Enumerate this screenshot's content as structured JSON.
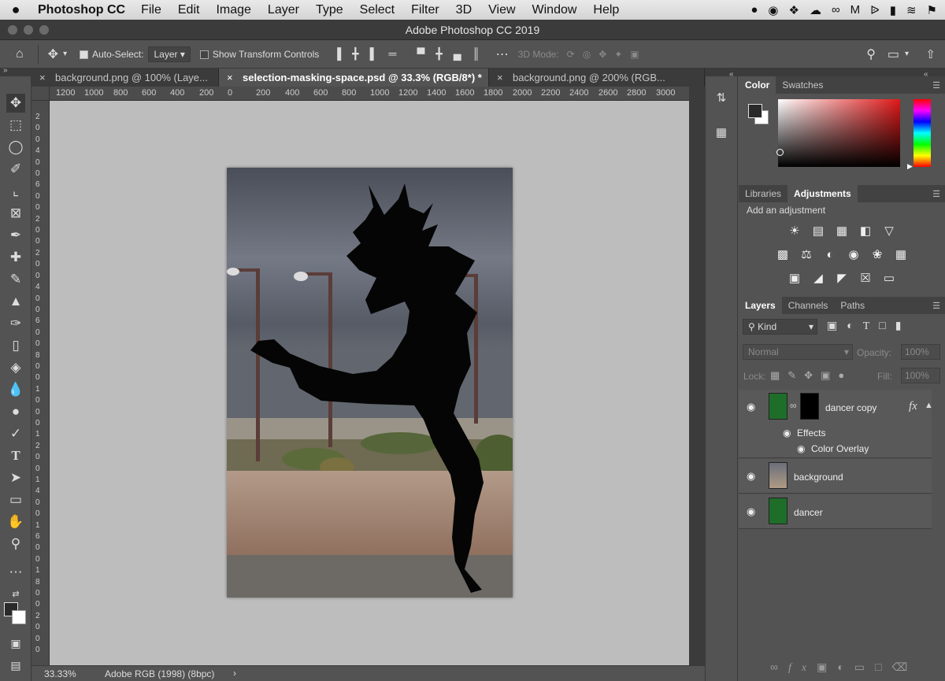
{
  "mac_menu": {
    "apple": "",
    "app_name": "Photoshop CC",
    "items": [
      "File",
      "Edit",
      "Image",
      "Layer",
      "Type",
      "Select",
      "Filter",
      "3D",
      "View",
      "Window",
      "Help"
    ]
  },
  "window_title": "Adobe Photoshop CC 2019",
  "options_bar": {
    "auto_select_label": "Auto-Select:",
    "auto_select_value": "Layer",
    "show_transform_label": "Show Transform Controls",
    "mode_3d_label": "3D Mode:"
  },
  "tabs": [
    {
      "label": "background.png @ 100% (Laye...",
      "active": false
    },
    {
      "label": "selection-masking-space.psd @ 33.3% (RGB/8*) *",
      "active": true
    },
    {
      "label": "background.png @ 200% (RGB...",
      "active": false
    }
  ],
  "ruler_h": [
    "1200",
    "1000",
    "800",
    "600",
    "400",
    "200",
    "0",
    "200",
    "400",
    "600",
    "800",
    "1000",
    "1200",
    "1400",
    "1600",
    "1800",
    "2000",
    "2200",
    "2400",
    "2600",
    "2800",
    "3000"
  ],
  "ruler_v": [
    "2",
    "0",
    "0",
    "4",
    "0",
    "0",
    "6",
    "0",
    "0",
    "2",
    "0",
    "0",
    "2",
    "0",
    "0",
    "4",
    "0",
    "0",
    "6",
    "0",
    "0",
    "8",
    "0",
    "0",
    "1",
    "0",
    "0",
    "0",
    "1",
    "2",
    "0",
    "0",
    "1",
    "4",
    "0",
    "0",
    "1",
    "6",
    "0",
    "0",
    "1",
    "8",
    "0",
    "0",
    "2",
    "0",
    "0",
    "0"
  ],
  "status": {
    "zoom": "33.33%",
    "profile": "Adobe RGB (1998) (8bpc)"
  },
  "color_panel": {
    "tabs": [
      "Color",
      "Swatches"
    ],
    "active": "Color"
  },
  "adjust_panel": {
    "tabs": [
      "Libraries",
      "Adjustments"
    ],
    "active": "Adjustments",
    "hint": "Add an adjustment"
  },
  "layers_panel": {
    "tabs": [
      "Layers",
      "Channels",
      "Paths"
    ],
    "active": "Layers",
    "kind_label": "Kind",
    "blend_mode": "Normal",
    "opacity_label": "Opacity:",
    "opacity_value": "100%",
    "lock_label": "Lock:",
    "fill_label": "Fill:",
    "fill_value": "100%",
    "layers": [
      {
        "name": "dancer copy",
        "effects_label": "Effects",
        "effect": "Color Overlay"
      },
      {
        "name": "background"
      },
      {
        "name": "dancer"
      }
    ]
  },
  "colors": {
    "accent_canvas": "#bdbdbd",
    "ui_dark": "#535353"
  }
}
